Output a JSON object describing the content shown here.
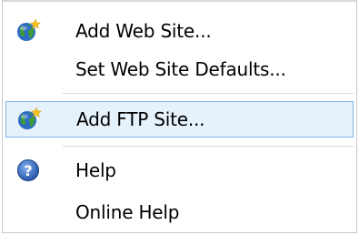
{
  "menu": {
    "items": [
      {
        "label": "Add Web Site...",
        "icon": "globe-star-icon"
      },
      {
        "label": "Set Web Site Defaults...",
        "icon": ""
      },
      {
        "label": "Add FTP Site...",
        "icon": "globe-star-icon",
        "highlighted": true
      },
      {
        "label": "Help",
        "icon": "help-icon"
      },
      {
        "label": "Online Help",
        "icon": ""
      }
    ]
  },
  "colors": {
    "highlight_bg": "#e5f1fb",
    "highlight_border": "#7eb4ea",
    "globe_blue": "#2b6cc4",
    "globe_green": "#3f9c35",
    "star_yellow": "#f6c21a",
    "help_blue": "#2b5fb8"
  }
}
